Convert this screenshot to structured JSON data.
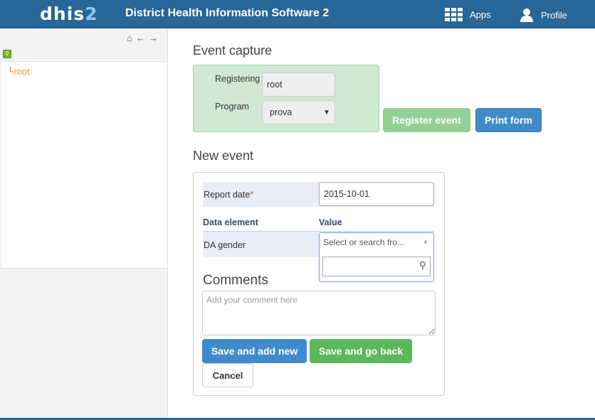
{
  "header": {
    "logo_main": "dhis",
    "logo_num": "2",
    "title": "District Health Information Software 2",
    "apps": "Apps",
    "profile": "Profile"
  },
  "sidebar": {
    "tree_root": "root"
  },
  "event_capture": {
    "heading": "Event capture",
    "registering_unit_label": "Registering unit",
    "registering_unit_value": "root",
    "program_label": "Program",
    "program_value": "prova",
    "register_button": "Register event",
    "print_button": "Print form"
  },
  "new_event": {
    "heading": "New event",
    "report_date_label": "Report date",
    "required_mark": "*",
    "report_date_value": "2015-10-01",
    "col_data_element": "Data element",
    "col_value": "Value",
    "da_gender_label": "DA gender",
    "da_gender_placeholder": "Select or search fro...",
    "comments_heading": "Comments",
    "comments_placeholder": "Add your comment here",
    "save_add_new": "Save and add new",
    "save_go_back": "Save and go back",
    "cancel": "Cancel"
  }
}
